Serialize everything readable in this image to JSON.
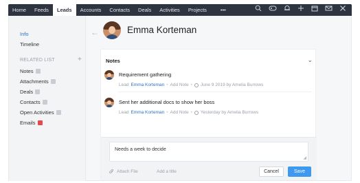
{
  "nav": {
    "items": [
      {
        "label": "Home",
        "active": false
      },
      {
        "label": "Feeds",
        "active": false
      },
      {
        "label": "Leads",
        "active": true
      },
      {
        "label": "Accounts",
        "active": false
      },
      {
        "label": "Contacts",
        "active": false
      },
      {
        "label": "Deals",
        "active": false
      },
      {
        "label": "Activities",
        "active": false
      },
      {
        "label": "Projects",
        "active": false
      }
    ],
    "more_label": "•••",
    "icons": [
      "search-icon",
      "gamepad-icon",
      "bell-icon",
      "plus-icon",
      "calendar-icon",
      "mail-icon",
      "tools-icon"
    ]
  },
  "sidebar": {
    "info": "Info",
    "timeline": "Timeline",
    "related_heading": "RELATED LIST",
    "add_symbol": "+",
    "related": [
      {
        "label": "Notes",
        "badge": "",
        "badge_color": "#c9ccd2"
      },
      {
        "label": "Attachments",
        "badge": "",
        "badge_color": "#c9ccd2"
      },
      {
        "label": "Deals",
        "badge": "",
        "badge_color": "#c9ccd2"
      },
      {
        "label": "Contacts",
        "badge": "",
        "badge_color": "#c9ccd2"
      },
      {
        "label": "Open Activities",
        "badge": "",
        "badge_color": "#c9ccd2"
      },
      {
        "label": "Emails",
        "badge": "",
        "badge_color": "#e5484d"
      }
    ]
  },
  "header": {
    "back_symbol": "←",
    "name": "Emma Korteman"
  },
  "notes": {
    "title": "Notes",
    "collapse_symbol": "⌄",
    "items": [
      {
        "text": "Requirement gathering",
        "meta_prefix": "Lead",
        "meta_link": "Emma Korteman",
        "meta_action": "Add Note",
        "meta_time": "June 9 2019 by Amelia Burrows"
      },
      {
        "text": "Sent her additional docs to show her boss",
        "meta_prefix": "Lead",
        "meta_link": "Emma Korteman",
        "meta_action": "Add Note",
        "meta_time": "Yesterday by Amelia Burrows"
      }
    ],
    "compose": {
      "value": "Needs a week to decide",
      "attach_label": "Attach File",
      "title_label": "Add a title",
      "cancel_label": "Cancel",
      "save_label": "Save"
    }
  },
  "colors": {
    "nav_bg": "#2e3440",
    "link": "#2d6fc7",
    "primary_button": "#3e9af0",
    "badge_alert": "#e5484d"
  }
}
